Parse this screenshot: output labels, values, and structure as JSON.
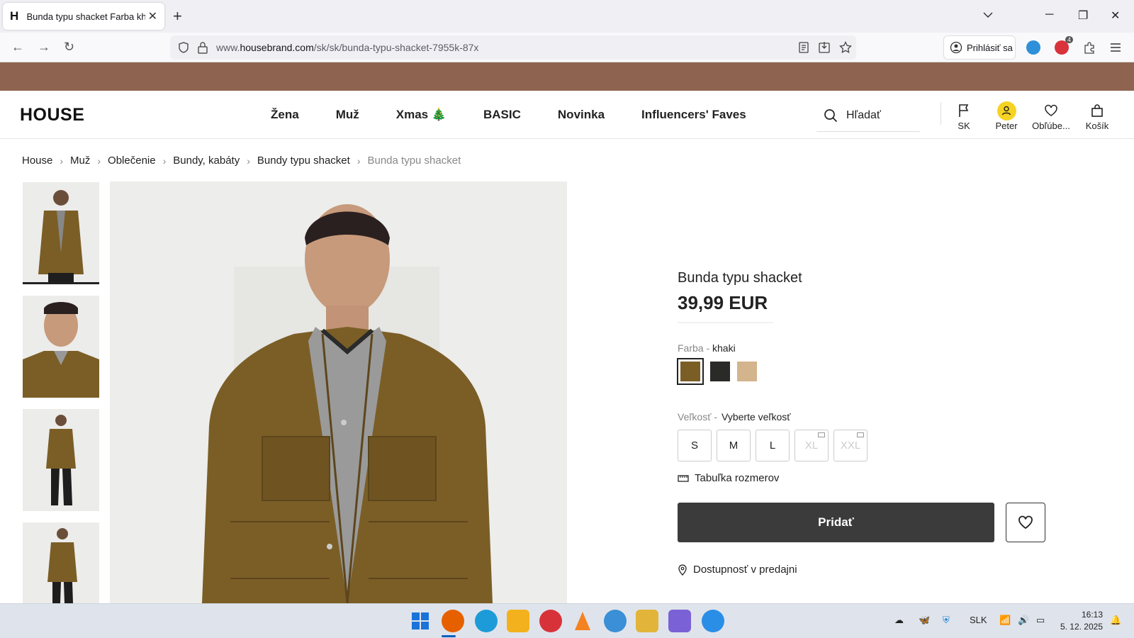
{
  "browser": {
    "tab_title": "Bunda typu shacket Farba khaki",
    "tab_favicon": "H",
    "url_prefix": "www.",
    "url_domain": "housebrand.com",
    "url_path": "/sk/sk/bunda-typu-shacket-7955k-87x",
    "signin_label": "Prihlásiť sa",
    "extension_badge": "4"
  },
  "header": {
    "logo": "HOUSE",
    "nav": [
      "Žena",
      "Muž",
      "Xmas 🎄",
      "BASIC",
      "Novinka",
      "Influencers' Faves"
    ],
    "search_placeholder": "Hľadať",
    "country": "SK",
    "user": "Peter",
    "favorites": "Obľúbe...",
    "cart": "Košík"
  },
  "breadcrumb": [
    "House",
    "Muž",
    "Oblečenie",
    "Bundy, kabáty",
    "Bundy typu shacket",
    "Bunda typu shacket"
  ],
  "product": {
    "name": "Bunda typu shacket",
    "price": "39,99 EUR",
    "color_label": "Farba -",
    "color_value": "khaki",
    "colors": [
      "#7b5e26",
      "#2a2a28",
      "#d4b48c"
    ],
    "size_label": "Veľkosť -",
    "size_value": "Vyberte veľkosť",
    "sizes": [
      "S",
      "M",
      "L",
      "XL",
      "XXL"
    ],
    "size_chart": "Tabuľka rozmerov",
    "add_button": "Pridať",
    "store_availability": "Dostupnosť v predajni"
  },
  "taskbar": {
    "lang": "SLK",
    "time": "16:13",
    "date": "5. 12. 2025"
  },
  "colors": {
    "banner": "#8e6450",
    "jacket": "#7b5e26",
    "button": "#3b3b3b"
  }
}
